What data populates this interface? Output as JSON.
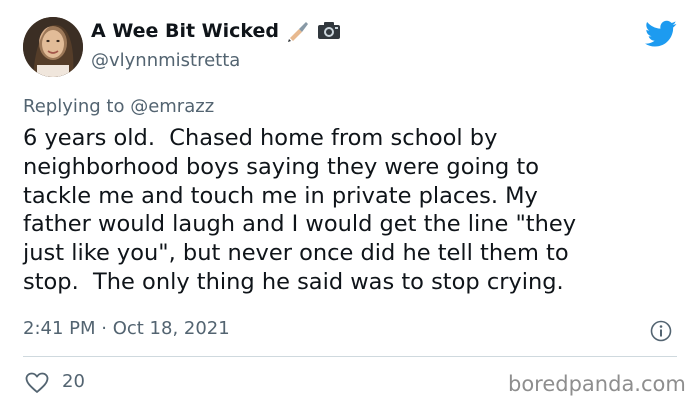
{
  "tweet": {
    "display_name": "A Wee Bit Wicked",
    "name_emojis": [
      "writing-hand-emoji",
      "camera-emoji"
    ],
    "handle": "@vlynnmistretta",
    "replying_prefix": "Replying to ",
    "replying_to": "@emrazz",
    "text": "6 years old.  Chased home from school by\nneighborhood boys saying they were going to\ntackle me and touch me in private places. My\nfather would laugh and I would get the line \"they\njust like you\", but never once did he tell them to\nstop.  The only thing he said was to stop crying.",
    "timestamp": "2:41 PM · Oct 18, 2021",
    "like_count": "20"
  },
  "watermark": "boredpanda.com",
  "colors": {
    "twitter_blue": "#1d9bf0",
    "secondary_text": "#536471",
    "primary_text": "#0f1419"
  }
}
